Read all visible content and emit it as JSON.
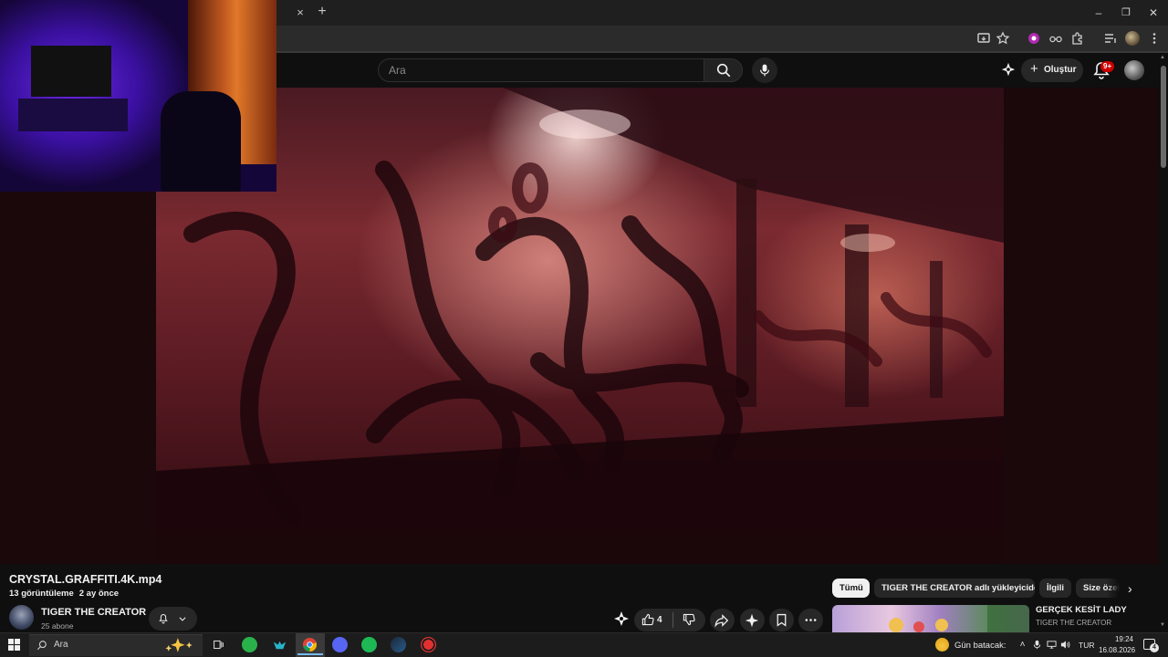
{
  "browser": {
    "tab_close": "×",
    "new_tab": "+",
    "window_controls": {
      "minimize": "–",
      "restore": "❐",
      "close": "✕"
    }
  },
  "youtube": {
    "search": {
      "placeholder": "Ara"
    },
    "create_label": "Oluştur",
    "notification_badge": "9+"
  },
  "video": {
    "title": "CRYSTAL.GRAFFITI.4K.mp4",
    "views": "13 görüntüleme",
    "age": "2 ay önce",
    "channel": {
      "name": "TIGER THE CREATOR",
      "subscribers": "25 abone"
    },
    "like_count": "4"
  },
  "chips": [
    {
      "label": "Tümü",
      "active": true
    },
    {
      "label": "TIGER THE CREATOR adlı yükleyiciden",
      "active": false
    },
    {
      "label": "İlgili",
      "active": false
    },
    {
      "label": "Size özel",
      "active": false
    }
  ],
  "recommendation": {
    "title": "GERÇEK KESİT LADY",
    "channel": "TIGER THE CREATOR"
  },
  "taskbar": {
    "search_text": "Ara",
    "weather": "Gün batacak:",
    "language": "TUR",
    "time": "19:24",
    "date": "16.08.2026",
    "notification_count": "4"
  },
  "colors": {
    "page_bg": "#0f0f0f",
    "chip_active_bg": "#f1f1f1",
    "notification_red": "#cc0000",
    "taskbar_accent": "#76b9ed"
  }
}
